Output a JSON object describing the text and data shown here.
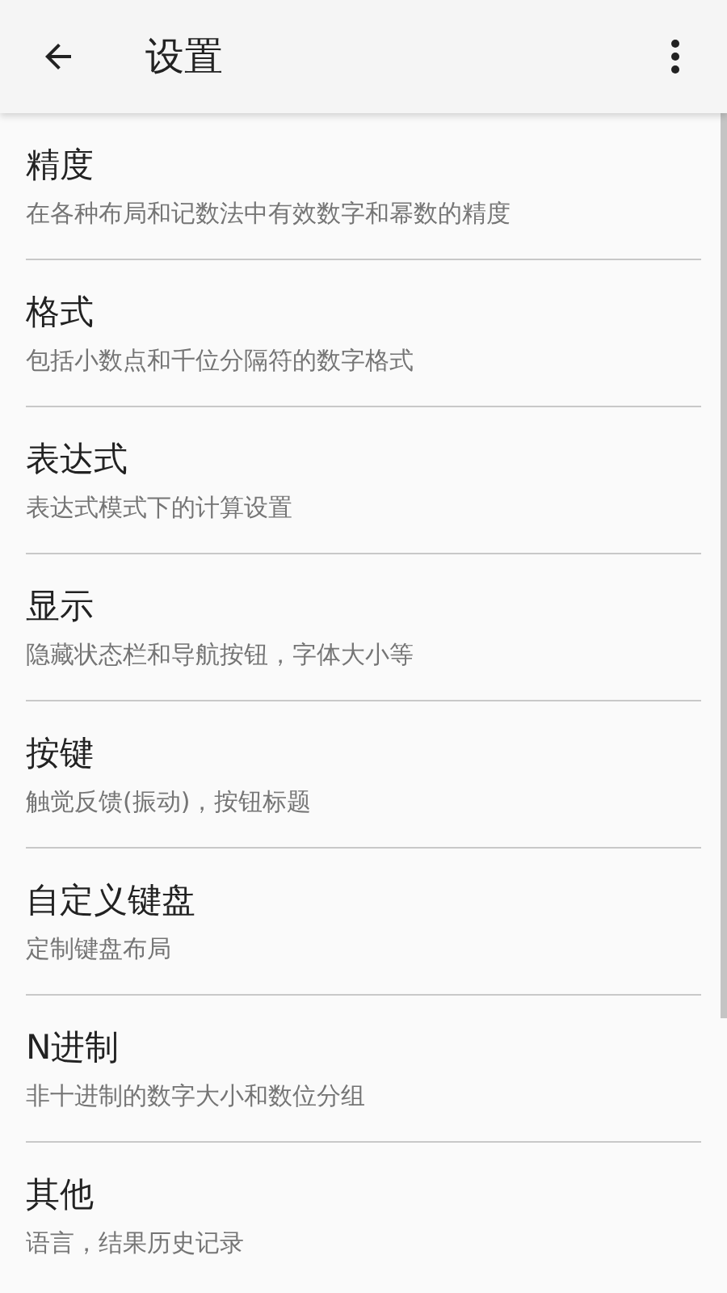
{
  "app_bar": {
    "title": "设置"
  },
  "items": [
    {
      "title": "精度",
      "subtitle": "在各种布局和记数法中有效数字和幂数的精度"
    },
    {
      "title": "格式",
      "subtitle": "包括小数点和千位分隔符的数字格式"
    },
    {
      "title": "表达式",
      "subtitle": "表达式模式下的计算设置"
    },
    {
      "title": "显示",
      "subtitle": "隐藏状态栏和导航按钮，字体大小等"
    },
    {
      "title": "按键",
      "subtitle": "触觉反馈(振动)，按钮标题"
    },
    {
      "title": "自定义键盘",
      "subtitle": "定制键盘布局"
    },
    {
      "title": "N进制",
      "subtitle": "非十进制的数字大小和数位分组"
    },
    {
      "title": "其他",
      "subtitle": "语言，结果历史记录"
    }
  ]
}
